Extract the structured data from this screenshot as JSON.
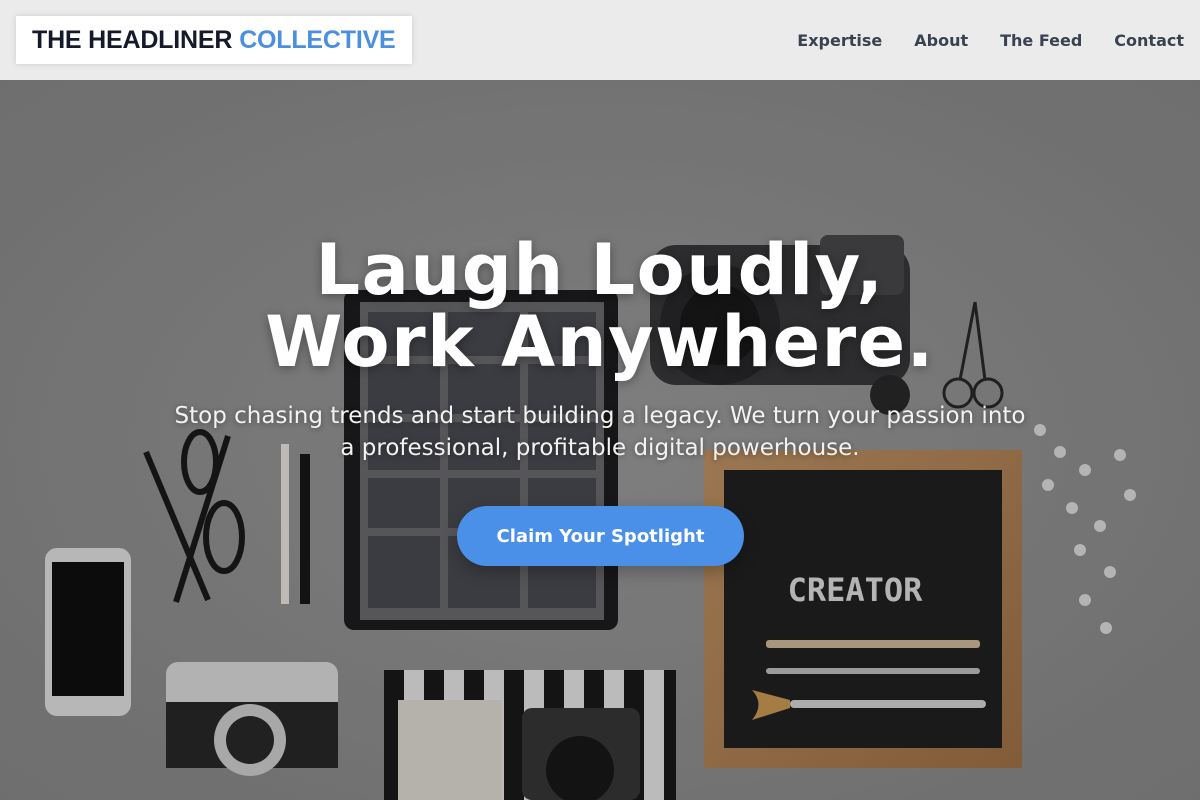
{
  "brand": {
    "part1": "THE HEADLINER",
    "part2": "COLLECTIVE",
    "accent_color": "#4a8fe0"
  },
  "nav": {
    "items": [
      "Expertise",
      "About",
      "The Feed",
      "Contact"
    ]
  },
  "hero": {
    "title_line1": "Laugh Loudly,",
    "title_line2": "Work Anywhere.",
    "subtitle": "Stop chasing trends and start building a legacy. We turn your passion into a professional, profitable digital powerhouse.",
    "cta_label": "Claim Your Spotlight",
    "cta_color": "#4a8fe8",
    "letterboard_text": "CREATOR"
  },
  "icons": [
    "tablet-icon",
    "camera-icon",
    "phone-icon",
    "glasses-icon",
    "scissors-icon",
    "pencil-icon",
    "brush-icon"
  ]
}
